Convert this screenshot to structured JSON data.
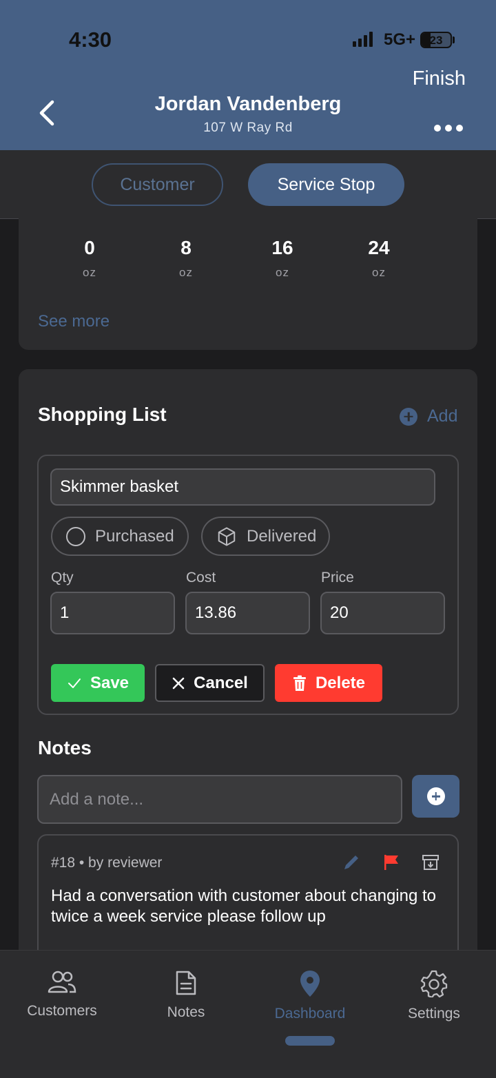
{
  "status_bar": {
    "time": "4:30",
    "network": "5G+",
    "battery": "23"
  },
  "header": {
    "finish_label": "Finish",
    "title": "Jordan Vandenberg",
    "subtitle": "107 W Ray Rd"
  },
  "tabs": [
    {
      "label": "Customer",
      "active": false
    },
    {
      "label": "Service Stop",
      "active": true
    }
  ],
  "dosage": {
    "items": [
      {
        "value": "0",
        "unit": "oz"
      },
      {
        "value": "8",
        "unit": "oz"
      },
      {
        "value": "16",
        "unit": "oz"
      },
      {
        "value": "24",
        "unit": "oz"
      }
    ],
    "see_more": "See more"
  },
  "shopping_list": {
    "title": "Shopping List",
    "add_label": "Add",
    "item": {
      "name": "Skimmer basket",
      "purchased_label": "Purchased",
      "delivered_label": "Delivered",
      "qty_label": "Qty",
      "qty": "1",
      "cost_label": "Cost",
      "cost": "13.86",
      "price_label": "Price",
      "price": "20"
    },
    "save_label": "Save",
    "cancel_label": "Cancel",
    "delete_label": "Delete"
  },
  "notes": {
    "title": "Notes",
    "placeholder": "Add a note...",
    "items": [
      {
        "meta": "#18 • by reviewer",
        "text": "Had a conversation with customer about changing to twice a week service please follow up"
      }
    ]
  },
  "bottom_nav": [
    {
      "label": "Customers",
      "icon": "users-icon",
      "active": false
    },
    {
      "label": "Notes",
      "icon": "document-icon",
      "active": false
    },
    {
      "label": "Dashboard",
      "icon": "map-pin-icon",
      "active": true
    },
    {
      "label": "Settings",
      "icon": "gear-icon",
      "active": false
    }
  ],
  "colors": {
    "header": "#466085",
    "accent_text": "#4b6992",
    "save": "#34c759",
    "delete": "#ff3b30",
    "flag": "#ff3b30"
  }
}
